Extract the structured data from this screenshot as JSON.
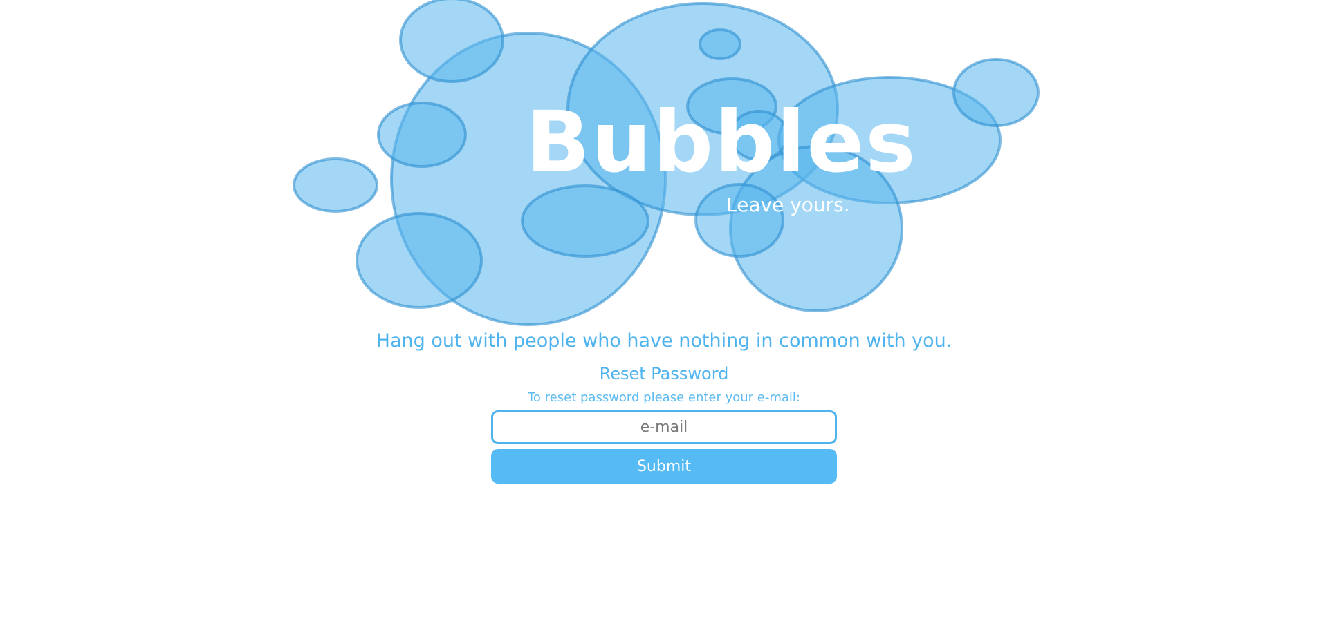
{
  "logo": {
    "title": "Bubbles",
    "tagline": "Leave yours."
  },
  "slogan": "Hang out with people who have nothing in common with you.",
  "reset": {
    "title": "Reset Password",
    "help": "To reset password please enter your e-mail:",
    "email_placeholder": "e-mail",
    "email_value": "",
    "submit_label": "Submit"
  },
  "colors": {
    "accent": "#4fb3ee",
    "bubble_fill": "#5ab6ec",
    "bubble_stroke": "#2f8fd0",
    "button": "#56bbf4"
  }
}
